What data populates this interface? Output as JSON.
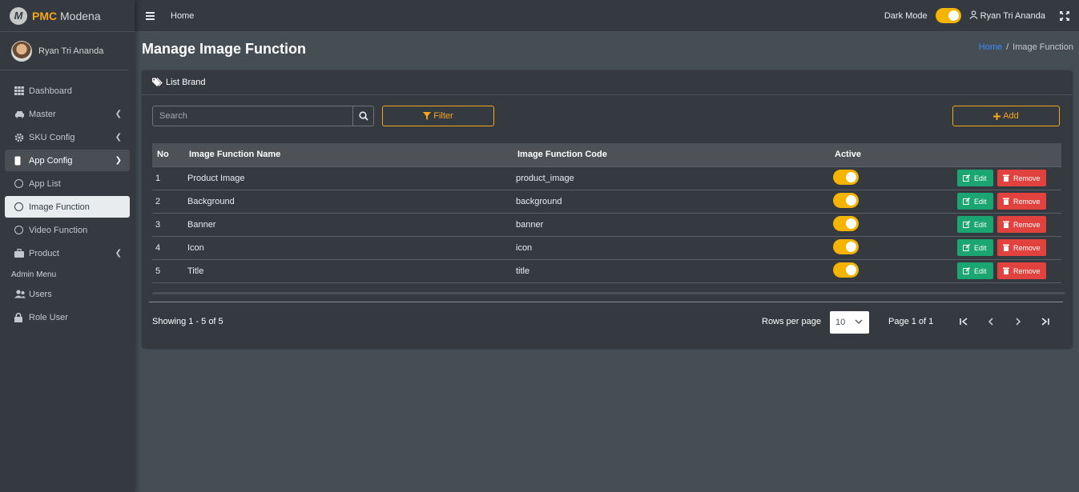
{
  "brand": {
    "accent": "PMC",
    "name": "Modena",
    "logo_letter": "M"
  },
  "sidebar": {
    "user_name": "Ryan Tri Ananda",
    "items": [
      {
        "label": "Dashboard",
        "icon": "table-grid-icon"
      },
      {
        "label": "Master",
        "icon": "car-icon"
      },
      {
        "label": "SKU Config",
        "icon": "gear-icon"
      },
      {
        "label": "App Config",
        "icon": "mobile-icon"
      },
      {
        "label": "App List",
        "icon": "circle-icon"
      },
      {
        "label": "Image Function",
        "icon": "circle-icon"
      },
      {
        "label": "Video Function",
        "icon": "circle-icon"
      },
      {
        "label": "Product",
        "icon": "briefcase-icon"
      }
    ],
    "admin_header": "Admin Menu",
    "admin_items": [
      {
        "label": "Users",
        "icon": "users-icon"
      },
      {
        "label": "Role User",
        "icon": "lock-icon"
      }
    ]
  },
  "topbar": {
    "home": "Home",
    "dark_mode_label": "Dark Mode",
    "user_name": "Ryan Tri Ananda"
  },
  "page": {
    "title": "Manage Image Function",
    "breadcrumb": {
      "home": "Home",
      "sep": "/",
      "current": "Image Function"
    }
  },
  "card": {
    "title": "List Brand",
    "search_placeholder": "Search",
    "filter_label": "Filter",
    "add_label": "Add"
  },
  "table": {
    "headers": {
      "no": "No",
      "name": "Image Function Name",
      "code": "Image Function Code",
      "active": "Active"
    },
    "rows": [
      {
        "no": "1",
        "name": "Product Image",
        "code": "product_image",
        "active": true
      },
      {
        "no": "2",
        "name": "Background",
        "code": "background",
        "active": true
      },
      {
        "no": "3",
        "name": "Banner",
        "code": "banner",
        "active": true
      },
      {
        "no": "4",
        "name": "Icon",
        "code": "icon",
        "active": true
      },
      {
        "no": "5",
        "name": "Title",
        "code": "title",
        "active": true
      }
    ],
    "edit_label": "Edit",
    "remove_label": "Remove"
  },
  "footer": {
    "showing": "Showing 1 - 5 of 5",
    "rows_per_page_label": "Rows per page",
    "rows_per_page_value": "10",
    "page_info": "Page 1 of 1"
  },
  "colors": {
    "accent": "#f7a51b",
    "toggle": "#f5b400",
    "edit": "#1aa572",
    "remove": "#e2423e",
    "link": "#3f8cff"
  }
}
